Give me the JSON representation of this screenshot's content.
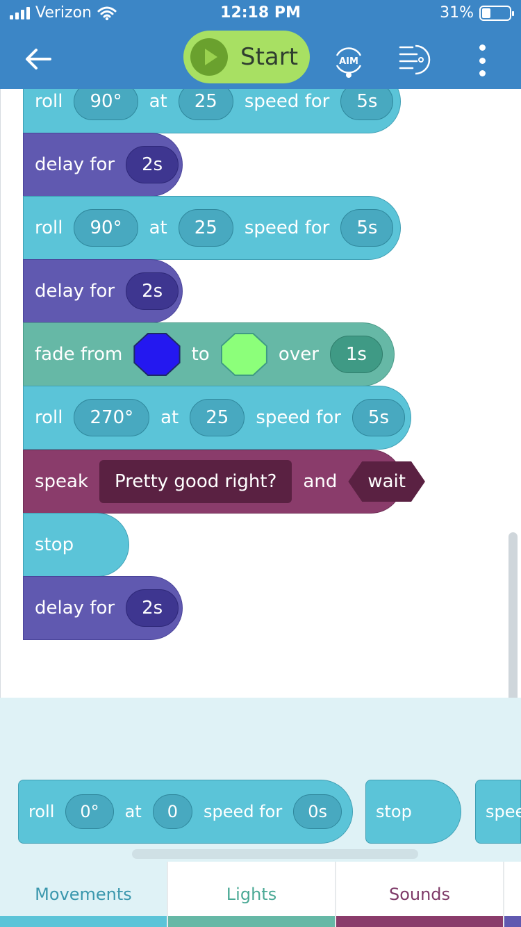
{
  "status_bar": {
    "carrier": "Verizon",
    "time": "12:18 PM",
    "battery": "31%"
  },
  "toolbar": {
    "start_label": "Start",
    "aim_label": "AIM"
  },
  "program": {
    "blocks": [
      {
        "type": "roll",
        "label": "roll",
        "heading": "90°",
        "at": "at",
        "speed": "25",
        "speed_for": "speed for",
        "duration": "5s"
      },
      {
        "type": "delay",
        "label": "delay for",
        "duration": "2s"
      },
      {
        "type": "roll",
        "label": "roll",
        "heading": "90°",
        "at": "at",
        "speed": "25",
        "speed_for": "speed for",
        "duration": "5s"
      },
      {
        "type": "delay",
        "label": "delay for",
        "duration": "2s"
      },
      {
        "type": "fade",
        "label": "fade from",
        "to": "to",
        "over": "over",
        "duration": "1s",
        "from_color": "#2418f0",
        "to_color": "#8cff7a"
      },
      {
        "type": "roll",
        "label": "roll",
        "heading": "270°",
        "at": "at",
        "speed": "25",
        "speed_for": "speed for",
        "duration": "5s"
      },
      {
        "type": "speak",
        "label": "speak",
        "text": "Pretty good right?",
        "and": "and",
        "wait": "wait"
      },
      {
        "type": "stop",
        "label": "stop"
      },
      {
        "type": "delay",
        "label": "delay for",
        "duration": "2s"
      }
    ]
  },
  "palette": {
    "roll": {
      "label": "roll",
      "heading": "0°",
      "at": "at",
      "speed": "0",
      "speed_for": "speed for",
      "duration": "0s"
    },
    "stop": {
      "label": "stop"
    },
    "speed": {
      "label": "spee"
    }
  },
  "tabs": [
    {
      "label": "Movements",
      "color": "#5bc4d8"
    },
    {
      "label": "Lights",
      "color": "#66b8a6"
    },
    {
      "label": "Sounds",
      "color": "#8a3c6b"
    }
  ],
  "colors": {
    "header": "#3c86c6",
    "start_button": "#a8e063",
    "roll_block": "#5bc4d8",
    "delay_block": "#6059b0",
    "fade_block": "#66b8a6",
    "speak_block": "#8a3c6b"
  }
}
